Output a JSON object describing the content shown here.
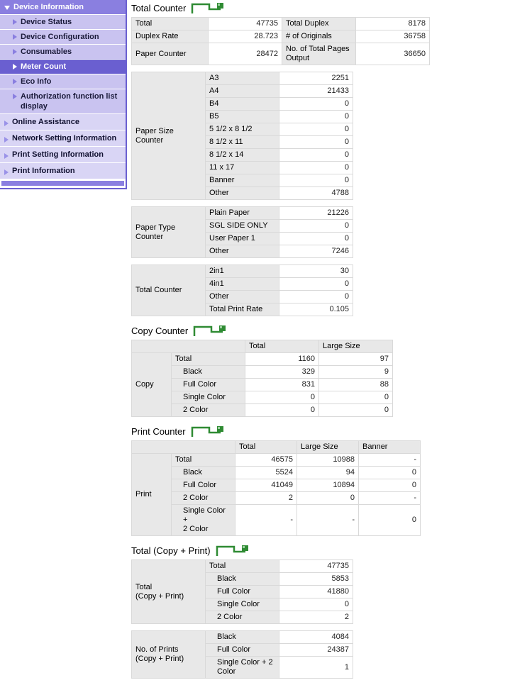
{
  "sidebar": {
    "root": {
      "label": "Device Information",
      "icon": "triangle-down-icon"
    },
    "children": [
      {
        "label": "Device Status",
        "selected": false
      },
      {
        "label": "Device Configuration",
        "selected": false
      },
      {
        "label": "Consumables",
        "selected": false
      },
      {
        "label": "Meter Count",
        "selected": true
      },
      {
        "label": "Eco Info",
        "selected": false
      },
      {
        "label": "Authorization function list display",
        "selected": false
      }
    ],
    "top_items": [
      {
        "label": "Online Assistance"
      },
      {
        "label": "Network Setting Information"
      },
      {
        "label": "Print Setting Information"
      },
      {
        "label": "Print Information"
      }
    ]
  },
  "sections": {
    "total_counter": {
      "title": "Total Counter",
      "icon": "green-flag-bracket-icon",
      "pairs": [
        {
          "l1": "Total",
          "v1": "47735",
          "l2": "Total Duplex",
          "v2": "8178"
        },
        {
          "l1": "Duplex Rate",
          "v1": "28.723",
          "l2": "# of Originals",
          "v2": "36758"
        },
        {
          "l1": "Paper Counter",
          "v1": "28472",
          "l2": "No. of Total Pages Output",
          "v2": "36650"
        }
      ]
    },
    "paper_size_counter": {
      "row_header": "Paper Size Counter",
      "rows": [
        {
          "label": "A3",
          "value": "2251"
        },
        {
          "label": "A4",
          "value": "21433"
        },
        {
          "label": "B4",
          "value": "0"
        },
        {
          "label": "B5",
          "value": "0"
        },
        {
          "label": "5 1/2 x 8 1/2",
          "value": "0"
        },
        {
          "label": "8 1/2 x 11",
          "value": "0"
        },
        {
          "label": "8 1/2 x 14",
          "value": "0"
        },
        {
          "label": "11 x 17",
          "value": "0"
        },
        {
          "label": "Banner",
          "value": "0"
        },
        {
          "label": "Other",
          "value": "4788"
        }
      ]
    },
    "paper_type_counter": {
      "row_header": "Paper Type\nCounter",
      "rows": [
        {
          "label": "Plain Paper",
          "value": "21226"
        },
        {
          "label": "SGL SIDE ONLY",
          "value": "0"
        },
        {
          "label": "User Paper 1",
          "value": "0"
        },
        {
          "label": "Other",
          "value": "7246"
        }
      ]
    },
    "total_counter_nup": {
      "row_header": "Total Counter",
      "rows": [
        {
          "label": "2in1",
          "value": "30"
        },
        {
          "label": "4in1",
          "value": "0"
        },
        {
          "label": "Other",
          "value": "0"
        },
        {
          "label": "Total Print Rate",
          "value": "0.105"
        }
      ]
    },
    "copy_counter": {
      "title": "Copy Counter",
      "icon": "green-flag-bracket-icon",
      "row_header": "Copy",
      "columns": [
        "",
        "Total",
        "Large Size"
      ],
      "rows": [
        {
          "label": "Total",
          "indent": false,
          "values": [
            "1160",
            "97"
          ]
        },
        {
          "label": "Black",
          "indent": true,
          "values": [
            "329",
            "9"
          ]
        },
        {
          "label": "Full Color",
          "indent": true,
          "values": [
            "831",
            "88"
          ]
        },
        {
          "label": "Single Color",
          "indent": true,
          "values": [
            "0",
            "0"
          ]
        },
        {
          "label": "2 Color",
          "indent": true,
          "values": [
            "0",
            "0"
          ]
        }
      ]
    },
    "print_counter": {
      "title": "Print Counter",
      "icon": "green-flag-bracket-icon",
      "row_header": "Print",
      "columns": [
        "",
        "Total",
        "Large Size",
        "Banner"
      ],
      "rows": [
        {
          "label": "Total",
          "indent": false,
          "values": [
            "46575",
            "10988",
            "-"
          ]
        },
        {
          "label": "Black",
          "indent": true,
          "values": [
            "5524",
            "94",
            "0"
          ]
        },
        {
          "label": "Full Color",
          "indent": true,
          "values": [
            "41049",
            "10894",
            "0"
          ]
        },
        {
          "label": "2 Color",
          "indent": true,
          "values": [
            "2",
            "0",
            "-"
          ]
        },
        {
          "label": "Single Color +\n2 Color",
          "indent": true,
          "values": [
            "-",
            "-",
            "0"
          ]
        }
      ]
    },
    "total_copy_print": {
      "title": "Total (Copy + Print)",
      "icon": "green-flag-bracket-icon",
      "row_header": "Total\n(Copy + Print)",
      "rows": [
        {
          "label": "Total",
          "indent": false,
          "value": "47735"
        },
        {
          "label": "Black",
          "indent": true,
          "value": "5853"
        },
        {
          "label": "Full Color",
          "indent": true,
          "value": "41880"
        },
        {
          "label": "Single Color",
          "indent": true,
          "value": "0"
        },
        {
          "label": "2 Color",
          "indent": true,
          "value": "2"
        }
      ]
    },
    "no_of_prints": {
      "row_header": "No. of Prints\n(Copy + Print)",
      "rows": [
        {
          "label": "Black",
          "indent": true,
          "value": "4084"
        },
        {
          "label": "Full Color",
          "indent": true,
          "value": "24387"
        },
        {
          "label": "Single Color + 2\nColor",
          "indent": true,
          "value": "1"
        }
      ]
    }
  },
  "colors": {
    "nav_header": "#8a7fe0",
    "nav_selected": "#6a5fd0",
    "nav_child": "#c9c3f0",
    "nav_top": "#d9d5f5",
    "icon_green": "#2f8b33",
    "table_header_bg": "#e8e8e8"
  }
}
